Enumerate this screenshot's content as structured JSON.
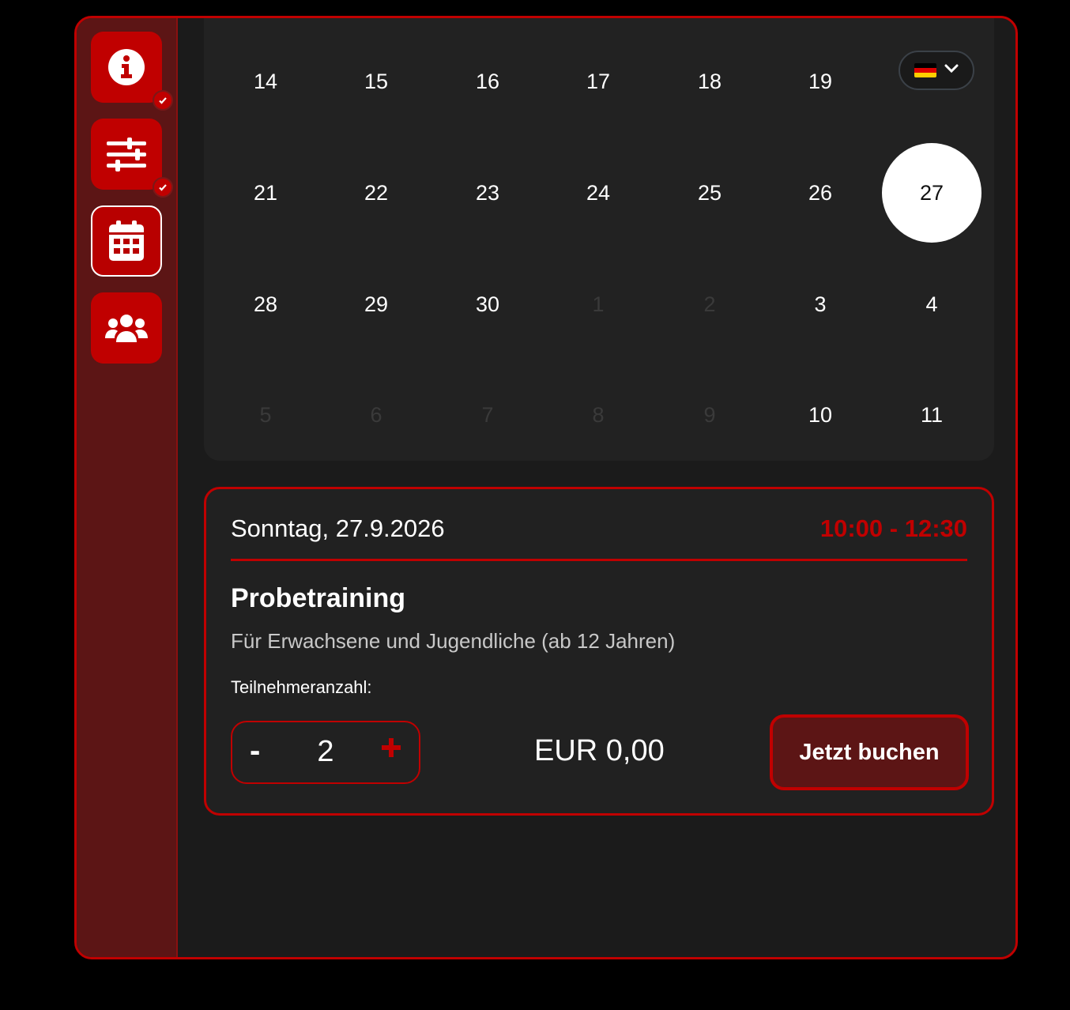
{
  "sidebar": {
    "items": [
      {
        "name": "info",
        "icon": "info-icon",
        "completed": true
      },
      {
        "name": "settings",
        "icon": "sliders-icon",
        "completed": true
      },
      {
        "name": "calendar",
        "icon": "calendar-icon",
        "active": true
      },
      {
        "name": "participants",
        "icon": "users-icon"
      }
    ]
  },
  "calendar": {
    "rows": [
      [
        {
          "d": "14"
        },
        {
          "d": "15"
        },
        {
          "d": "16"
        },
        {
          "d": "17"
        },
        {
          "d": "18"
        },
        {
          "d": "19"
        }
      ],
      [
        {
          "d": "21"
        },
        {
          "d": "22"
        },
        {
          "d": "23"
        },
        {
          "d": "24"
        },
        {
          "d": "25"
        },
        {
          "d": "26"
        },
        {
          "d": "27",
          "selected": true
        }
      ],
      [
        {
          "d": "28"
        },
        {
          "d": "29"
        },
        {
          "d": "30"
        },
        {
          "d": "1",
          "disabled": true
        },
        {
          "d": "2",
          "disabled": true
        },
        {
          "d": "3"
        },
        {
          "d": "4"
        }
      ],
      [
        {
          "d": "5",
          "disabled": true
        },
        {
          "d": "6",
          "disabled": true
        },
        {
          "d": "7",
          "disabled": true
        },
        {
          "d": "8",
          "disabled": true
        },
        {
          "d": "9",
          "disabled": true
        },
        {
          "d": "10"
        },
        {
          "d": "11"
        }
      ]
    ]
  },
  "language": {
    "selected": "de",
    "icon": "german-flag-icon"
  },
  "event": {
    "date": "Sonntag, 27.9.2026",
    "time": "10:00 - 12:30",
    "title": "Probetraining",
    "description": "Für Erwachsene und Jugendliche (ab 12 Jahren)",
    "participants_label": "Teilnehmeranzahl:",
    "minus_label": "-",
    "quantity": "2",
    "price": "EUR 0,00",
    "book_label": "Jetzt buchen"
  },
  "colors": {
    "accent": "#c00000",
    "sidebar": "#5c1515",
    "panel": "#222222",
    "background": "#1b1b1b"
  }
}
